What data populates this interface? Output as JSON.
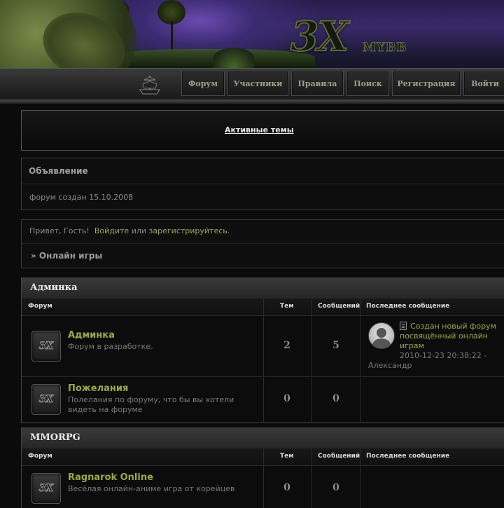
{
  "header": {
    "logo_text": "3X",
    "logo_sub": "MYBB"
  },
  "nav": {
    "items": [
      {
        "label": "Форум"
      },
      {
        "label": "Участники"
      },
      {
        "label": "Правила"
      },
      {
        "label": "Поиск"
      },
      {
        "label": "Регистрация"
      },
      {
        "label": "Войти"
      }
    ]
  },
  "active_topics": "Активные темы",
  "announcement": {
    "title": "Объявление",
    "text": "форум создан 15.10.2008"
  },
  "greeting": {
    "prefix": "Привет, Гость!",
    "login": "Войдите",
    "or": "или",
    "register": "зарегистрируйтесь",
    "suffix": "."
  },
  "breadcrumb": "» Онлайн игры",
  "columns": {
    "forum": "Форум",
    "topics": "Тем",
    "posts": "Сообщений",
    "last": "Последнее сообщение"
  },
  "categories": [
    {
      "name": "Админка",
      "forums": [
        {
          "title": "Админка",
          "desc": "Форум в разработке.",
          "topics": "2",
          "posts": "5",
          "last": {
            "title": "Создан новый форум посвящённый онлайн играм",
            "date": "2010-12-23 20:38:22 -",
            "author": "Александр"
          }
        },
        {
          "title": "Пожелания",
          "desc": "Полелания по форуму, что бы вы хотели видеть на форуме",
          "topics": "0",
          "posts": "0"
        }
      ]
    },
    {
      "name": "MMORPG",
      "forums": [
        {
          "title": "Ragnarok Online",
          "desc": "Весёлая онлайн-аниме игра от корейцев",
          "topics": "0",
          "posts": "0"
        }
      ]
    }
  ],
  "forum_icon_text": "3X"
}
